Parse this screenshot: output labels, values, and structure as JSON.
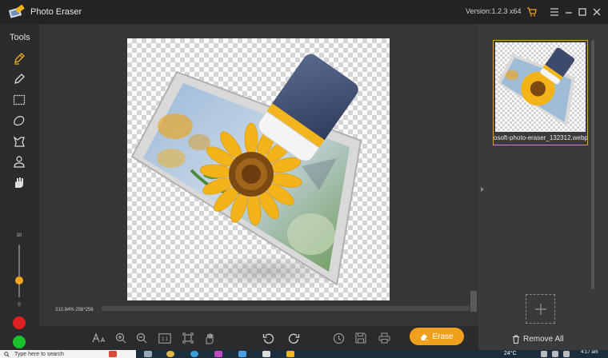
{
  "titlebar": {
    "title": "Photo Eraser",
    "version": "Version:1.2.3 x64"
  },
  "tools": {
    "label": "Tools",
    "items": [
      "smart-brush",
      "brush",
      "rectangle-select",
      "lasso-select",
      "polygon-select",
      "person-select",
      "hand-erase"
    ],
    "brush_size": {
      "max": "30",
      "min": "0",
      "value_fraction": 0.4
    }
  },
  "canvas": {
    "zoom_info": "210.94%  256*256"
  },
  "bottom_toolbar": {
    "erase_label": "Erase",
    "ratio_label": "1:1"
  },
  "right_panel": {
    "file_name": "osoft-photo-eraser_132312.webp",
    "remove_all_label": "Remove All"
  },
  "taskbar": {
    "search_placeholder": "Type here to search",
    "weather": "24°C",
    "time": "4:17 am"
  },
  "colors": {
    "accent": "#f0a01c",
    "red_dot": "#e02020",
    "green_dot": "#19c22b",
    "bg": "#2b2b2e"
  }
}
